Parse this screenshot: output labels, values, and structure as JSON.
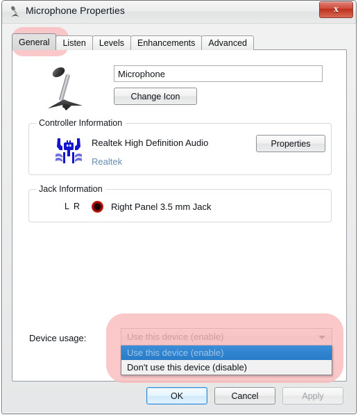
{
  "window": {
    "title": "Microphone Properties",
    "title_icon": "microphone-icon",
    "close_label": "x"
  },
  "tabs": [
    {
      "label": "General",
      "active": true
    },
    {
      "label": "Listen",
      "active": false
    },
    {
      "label": "Levels",
      "active": false
    },
    {
      "label": "Enhancements",
      "active": false
    },
    {
      "label": "Advanced",
      "active": false
    }
  ],
  "general": {
    "device_icon": "microphone-icon",
    "name_value": "Microphone",
    "name_placeholder": "Microphone",
    "change_icon_label": "Change Icon",
    "controller": {
      "group_title": "Controller Information",
      "logo": "realtek-crab-logo",
      "name": "Realtek High Definition Audio",
      "link": "Realtek",
      "properties_label": "Properties"
    },
    "jack": {
      "group_title": "Jack Information",
      "channels": "L R",
      "connector_color": "#c2161a",
      "label": "Right Panel 3.5 mm Jack"
    },
    "device_usage": {
      "label": "Device usage:",
      "selected": "Use this device (enable)",
      "options": [
        "Use this device (enable)",
        "Don't use this device (disable)"
      ],
      "expanded": true
    }
  },
  "footer": {
    "ok_label": "OK",
    "cancel_label": "Cancel",
    "apply_label": "Apply",
    "apply_disabled": true
  },
  "annotations": {
    "highlight_color": "#f9bcbc",
    "targets": [
      "general-tab",
      "device-usage-dropdown"
    ]
  }
}
